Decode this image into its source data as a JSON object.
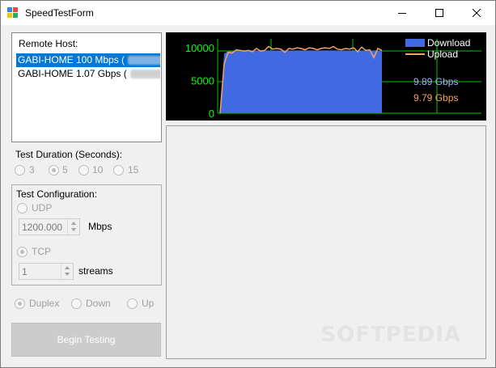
{
  "window": {
    "title": "SpeedTestForm",
    "minimize_icon": "minimize-icon",
    "maximize_icon": "maximize-icon",
    "close_icon": "close-icon"
  },
  "remote_host": {
    "header": "Remote Host:",
    "items": [
      {
        "label": "GABI-HOME 100 Mbps (",
        "selected": true
      },
      {
        "label": "GABI-HOME 1.07 Gbps (",
        "selected": false
      }
    ]
  },
  "test_duration": {
    "label": "Test Duration (Seconds):",
    "options": [
      {
        "label": "3",
        "checked": false
      },
      {
        "label": "5",
        "checked": true
      },
      {
        "label": "10",
        "checked": false
      },
      {
        "label": "15",
        "checked": false
      }
    ]
  },
  "test_configuration": {
    "label": "Test Configuration:",
    "udp_label": "UDP",
    "udp_value": "1200.000",
    "udp_unit": "Mbps",
    "tcp_label": "TCP",
    "tcp_value": "1",
    "tcp_unit": "streams"
  },
  "direction": {
    "options": [
      {
        "label": "Duplex",
        "checked": true
      },
      {
        "label": "Down",
        "checked": false
      },
      {
        "label": "Up",
        "checked": false
      }
    ]
  },
  "begin_button": "Begin Testing",
  "watermark": "SOFTPEDIA",
  "colors": {
    "download": "#4169e1",
    "upload": "#f4a460",
    "grid": "#00c800",
    "axis_text": "#00ff00",
    "download_rate_text": "#aaaaff",
    "upload_rate_text": "#f4a460"
  },
  "chart_data": {
    "type": "area",
    "title": "",
    "xlabel": "",
    "ylabel": "",
    "ylim": [
      0,
      11000
    ],
    "yticks": [
      "10000",
      "5000",
      "0"
    ],
    "ytick_values": [
      10000,
      5000,
      0
    ],
    "grid": true,
    "legend_position": "top-right",
    "download_rate": "9.89 Gbps",
    "upload_rate": "9.79 Gbps",
    "series": [
      {
        "name": "Download",
        "values": [
          0,
          9100,
          9500,
          9500,
          9500,
          9600,
          9600,
          9600,
          9600,
          9600,
          9600,
          9600,
          9600,
          9600,
          9600,
          9600,
          9600,
          9600,
          9600,
          9600,
          9600,
          9600,
          9600,
          9600,
          9600,
          9600,
          9600,
          9600,
          9600,
          9600,
          9600,
          9600,
          9600,
          9600,
          9600,
          9600,
          9600,
          9600,
          9600,
          9600,
          9600
        ]
      },
      {
        "name": "Upload",
        "values": [
          0,
          7500,
          9300,
          9200,
          9700,
          9600,
          9500,
          9600,
          9400,
          9900,
          9500,
          9600,
          10200,
          9800,
          9900,
          9800,
          9300,
          9900,
          9800,
          10000,
          9900,
          9700,
          10000,
          9900,
          9700,
          9900,
          10000,
          9900,
          10200,
          9800,
          9700,
          9900,
          9800,
          10000,
          9400,
          10100,
          9600,
          9700,
          8500,
          9900,
          9600
        ]
      }
    ]
  }
}
